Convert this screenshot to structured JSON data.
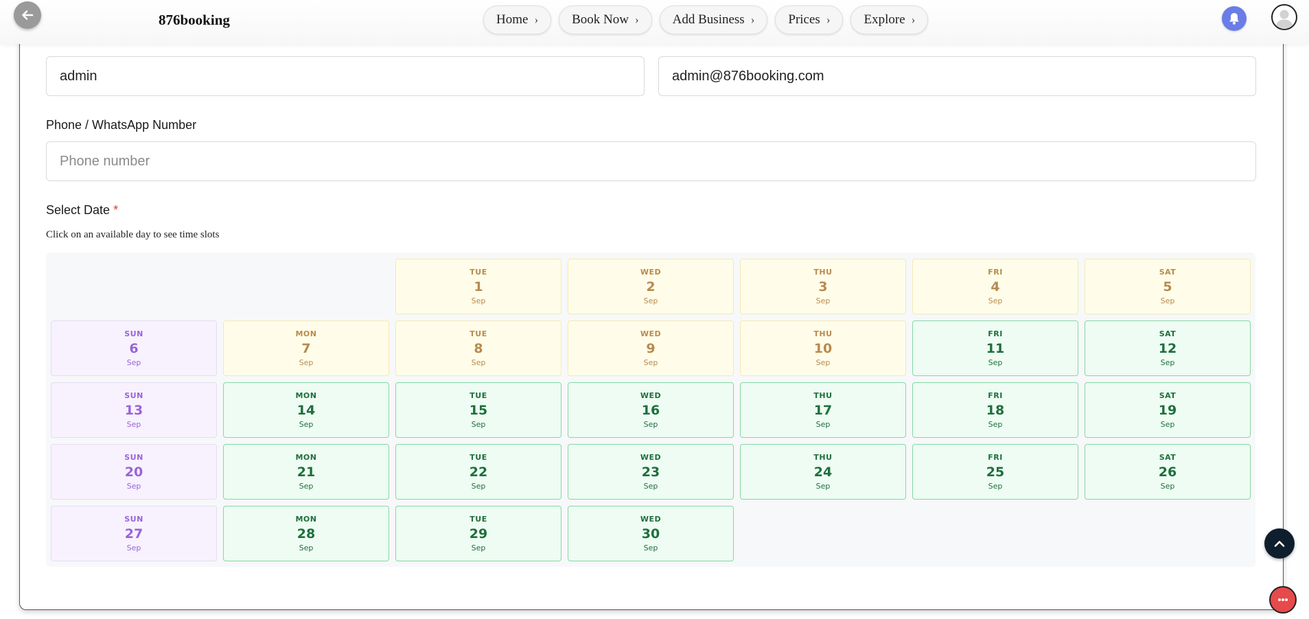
{
  "header": {
    "brand": "876booking",
    "nav": [
      {
        "label": "Home",
        "chevron": "›"
      },
      {
        "label": "Book Now",
        "chevron": "›"
      },
      {
        "label": "Add Business",
        "chevron": "›"
      },
      {
        "label": "Prices",
        "chevron": "›"
      },
      {
        "label": "Explore",
        "chevron": "›"
      }
    ],
    "icons": {
      "back": "arrow-left-icon",
      "notifications": "bell-icon",
      "profile": "user-avatar-icon"
    },
    "colors": {
      "bell": "#6a7de6",
      "back": "#9a9a9a"
    }
  },
  "form": {
    "name_value": "admin",
    "email_value": "admin@876booking.com",
    "phone_label": "Phone / WhatsApp Number",
    "phone_placeholder": "Phone number",
    "date_label": "Select Date",
    "required_mark": "*",
    "date_hint": "Click on an available day to see time slots"
  },
  "calendar": {
    "month_abbr": "Sep",
    "first_weekday_index": 2,
    "colors": {
      "past": "#b88a4e",
      "available": "#1f6e3d",
      "sunday": "#9a63d8"
    },
    "days": [
      {
        "dow": "TUE",
        "day": "1",
        "mon": "Sep",
        "state": "past"
      },
      {
        "dow": "WED",
        "day": "2",
        "mon": "Sep",
        "state": "past"
      },
      {
        "dow": "THU",
        "day": "3",
        "mon": "Sep",
        "state": "past"
      },
      {
        "dow": "FRI",
        "day": "4",
        "mon": "Sep",
        "state": "past"
      },
      {
        "dow": "SAT",
        "day": "5",
        "mon": "Sep",
        "state": "past"
      },
      {
        "dow": "SUN",
        "day": "6",
        "mon": "Sep",
        "state": "sun"
      },
      {
        "dow": "MON",
        "day": "7",
        "mon": "Sep",
        "state": "past"
      },
      {
        "dow": "TUE",
        "day": "8",
        "mon": "Sep",
        "state": "past"
      },
      {
        "dow": "WED",
        "day": "9",
        "mon": "Sep",
        "state": "past"
      },
      {
        "dow": "THU",
        "day": "10",
        "mon": "Sep",
        "state": "past"
      },
      {
        "dow": "FRI",
        "day": "11",
        "mon": "Sep",
        "state": "avail"
      },
      {
        "dow": "SAT",
        "day": "12",
        "mon": "Sep",
        "state": "avail"
      },
      {
        "dow": "SUN",
        "day": "13",
        "mon": "Sep",
        "state": "sun"
      },
      {
        "dow": "MON",
        "day": "14",
        "mon": "Sep",
        "state": "avail"
      },
      {
        "dow": "TUE",
        "day": "15",
        "mon": "Sep",
        "state": "avail"
      },
      {
        "dow": "WED",
        "day": "16",
        "mon": "Sep",
        "state": "avail"
      },
      {
        "dow": "THU",
        "day": "17",
        "mon": "Sep",
        "state": "avail"
      },
      {
        "dow": "FRI",
        "day": "18",
        "mon": "Sep",
        "state": "avail"
      },
      {
        "dow": "SAT",
        "day": "19",
        "mon": "Sep",
        "state": "avail"
      },
      {
        "dow": "SUN",
        "day": "20",
        "mon": "Sep",
        "state": "sun"
      },
      {
        "dow": "MON",
        "day": "21",
        "mon": "Sep",
        "state": "avail"
      },
      {
        "dow": "TUE",
        "day": "22",
        "mon": "Sep",
        "state": "avail"
      },
      {
        "dow": "WED",
        "day": "23",
        "mon": "Sep",
        "state": "avail"
      },
      {
        "dow": "THU",
        "day": "24",
        "mon": "Sep",
        "state": "avail"
      },
      {
        "dow": "FRI",
        "day": "25",
        "mon": "Sep",
        "state": "avail"
      },
      {
        "dow": "SAT",
        "day": "26",
        "mon": "Sep",
        "state": "avail"
      },
      {
        "dow": "SUN",
        "day": "27",
        "mon": "Sep",
        "state": "sun"
      },
      {
        "dow": "MON",
        "day": "28",
        "mon": "Sep",
        "state": "avail"
      },
      {
        "dow": "TUE",
        "day": "29",
        "mon": "Sep",
        "state": "avail"
      },
      {
        "dow": "WED",
        "day": "30",
        "mon": "Sep",
        "state": "avail"
      }
    ]
  },
  "floating": {
    "scroll_top": "chevron-up-icon",
    "chat": "chat-support-icon"
  }
}
